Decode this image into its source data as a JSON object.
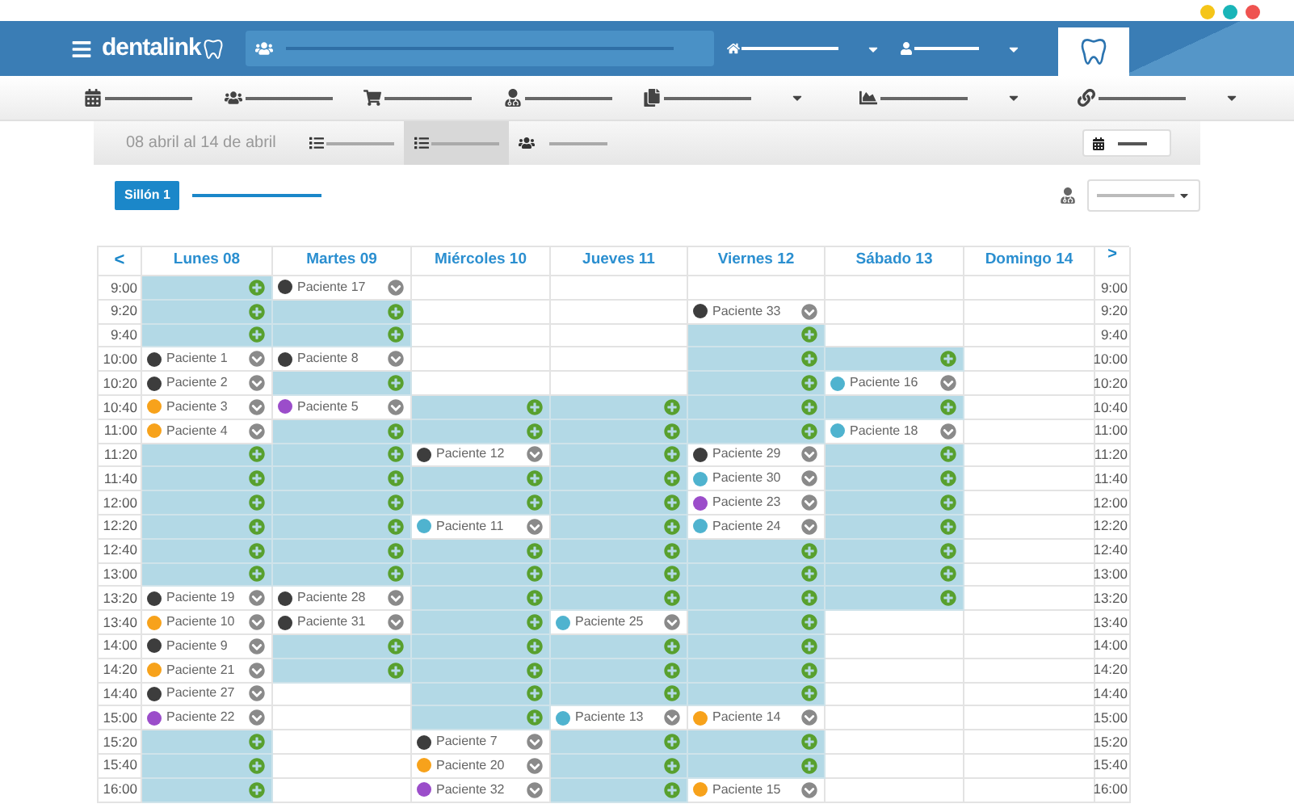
{
  "header": {
    "logo": "dentalink",
    "nav": [
      {
        "kind": "home",
        "dropdown": true
      },
      {
        "kind": "user",
        "dropdown": true
      }
    ]
  },
  "toolbar": [
    {
      "kind": "calendar",
      "dropdown": false
    },
    {
      "kind": "group",
      "dropdown": false
    },
    {
      "kind": "cart",
      "dropdown": false
    },
    {
      "kind": "doctor",
      "dropdown": false
    },
    {
      "kind": "files",
      "dropdown": true
    },
    {
      "kind": "chart",
      "dropdown": true
    },
    {
      "kind": "link",
      "dropdown": true
    }
  ],
  "subheader": {
    "date_range": "08 abril al 14 de abril",
    "view_tabs": [
      {
        "kind": "list",
        "selected": false
      },
      {
        "kind": "list",
        "selected": true
      },
      {
        "kind": "group",
        "selected": false
      }
    ]
  },
  "chair": {
    "label": "Sillón 1"
  },
  "calendar": {
    "prev": "<",
    "next": ">",
    "days": [
      "Lunes 08",
      "Martes 09",
      "Miércoles 10",
      "Jueves 11",
      "Viernes 12",
      "Sábado 13",
      "Domingo 14"
    ],
    "rows": [
      {
        "time": "9:00",
        "time_right": "9:00",
        "slots": [
          {
            "kind": "free"
          },
          {
            "kind": "appointment",
            "patient": "Paciente 17",
            "color": "#3d3d3d"
          },
          {
            "kind": "empty"
          },
          {
            "kind": "empty"
          },
          {
            "kind": "empty"
          },
          {
            "kind": "empty"
          },
          {
            "kind": "empty"
          }
        ]
      },
      {
        "time": "9:20",
        "time_right": "9:20",
        "slots": [
          {
            "kind": "free"
          },
          {
            "kind": "free"
          },
          {
            "kind": "empty"
          },
          {
            "kind": "empty"
          },
          {
            "kind": "appointment",
            "patient": "Paciente 33",
            "color": "#3d3d3d"
          },
          {
            "kind": "empty"
          },
          {
            "kind": "empty"
          }
        ]
      },
      {
        "time": "9:40",
        "time_right": "9:40",
        "slots": [
          {
            "kind": "free"
          },
          {
            "kind": "free"
          },
          {
            "kind": "empty"
          },
          {
            "kind": "empty"
          },
          {
            "kind": "free"
          },
          {
            "kind": "empty"
          },
          {
            "kind": "empty"
          }
        ]
      },
      {
        "time": "10:00",
        "time_right": "10:00",
        "slots": [
          {
            "kind": "appointment",
            "patient": "Paciente 1",
            "color": "#3d3d3d"
          },
          {
            "kind": "appointment",
            "patient": "Paciente 8",
            "color": "#3d3d3d"
          },
          {
            "kind": "empty"
          },
          {
            "kind": "empty"
          },
          {
            "kind": "free"
          },
          {
            "kind": "free"
          },
          {
            "kind": "empty"
          }
        ]
      },
      {
        "time": "10:20",
        "time_right": "10:20",
        "slots": [
          {
            "kind": "appointment",
            "patient": "Paciente 2",
            "color": "#3d3d3d"
          },
          {
            "kind": "free"
          },
          {
            "kind": "empty"
          },
          {
            "kind": "empty"
          },
          {
            "kind": "free"
          },
          {
            "kind": "appointment",
            "patient": "Paciente 16",
            "color": "#4fb3cf"
          },
          {
            "kind": "empty"
          }
        ]
      },
      {
        "time": "10:40",
        "time_right": "10:40",
        "slots": [
          {
            "kind": "appointment",
            "patient": "Paciente 3",
            "color": "#f7a21b"
          },
          {
            "kind": "appointment",
            "patient": "Paciente 5",
            "color": "#9b4dca"
          },
          {
            "kind": "free"
          },
          {
            "kind": "free"
          },
          {
            "kind": "free"
          },
          {
            "kind": "free"
          },
          {
            "kind": "empty"
          }
        ]
      },
      {
        "time": "11:00",
        "time_right": "11:00",
        "slots": [
          {
            "kind": "appointment",
            "patient": "Paciente 4",
            "color": "#f7a21b"
          },
          {
            "kind": "free"
          },
          {
            "kind": "free"
          },
          {
            "kind": "free"
          },
          {
            "kind": "free"
          },
          {
            "kind": "appointment",
            "patient": "Paciente 18",
            "color": "#4fb3cf"
          },
          {
            "kind": "empty"
          }
        ]
      },
      {
        "time": "11:20",
        "time_right": "11:20",
        "slots": [
          {
            "kind": "free"
          },
          {
            "kind": "free"
          },
          {
            "kind": "appointment",
            "patient": "Paciente 12",
            "color": "#3d3d3d"
          },
          {
            "kind": "free"
          },
          {
            "kind": "appointment",
            "patient": "Paciente 29",
            "color": "#3d3d3d"
          },
          {
            "kind": "free"
          },
          {
            "kind": "empty"
          }
        ]
      },
      {
        "time": "11:40",
        "time_right": "11:40",
        "slots": [
          {
            "kind": "free"
          },
          {
            "kind": "free"
          },
          {
            "kind": "free"
          },
          {
            "kind": "free"
          },
          {
            "kind": "appointment",
            "patient": "Paciente 30",
            "color": "#4fb3cf"
          },
          {
            "kind": "free"
          },
          {
            "kind": "empty"
          }
        ]
      },
      {
        "time": "12:00",
        "time_right": "12:00",
        "slots": [
          {
            "kind": "free"
          },
          {
            "kind": "free"
          },
          {
            "kind": "free"
          },
          {
            "kind": "free"
          },
          {
            "kind": "appointment",
            "patient": "Paciente 23",
            "color": "#9b4dca"
          },
          {
            "kind": "free"
          },
          {
            "kind": "empty"
          }
        ]
      },
      {
        "time": "12:20",
        "time_right": "12:20",
        "slots": [
          {
            "kind": "free"
          },
          {
            "kind": "free"
          },
          {
            "kind": "appointment",
            "patient": "Paciente 11",
            "color": "#4fb3cf"
          },
          {
            "kind": "free"
          },
          {
            "kind": "appointment",
            "patient": "Paciente 24",
            "color": "#4fb3cf"
          },
          {
            "kind": "free"
          },
          {
            "kind": "empty"
          }
        ]
      },
      {
        "time": "12:40",
        "time_right": "12:40",
        "slots": [
          {
            "kind": "free"
          },
          {
            "kind": "free"
          },
          {
            "kind": "free"
          },
          {
            "kind": "free"
          },
          {
            "kind": "free"
          },
          {
            "kind": "free"
          },
          {
            "kind": "empty"
          }
        ]
      },
      {
        "time": "13:00",
        "time_right": "13:00",
        "slots": [
          {
            "kind": "free"
          },
          {
            "kind": "free"
          },
          {
            "kind": "free"
          },
          {
            "kind": "free"
          },
          {
            "kind": "free"
          },
          {
            "kind": "free"
          },
          {
            "kind": "empty"
          }
        ]
      },
      {
        "time": "13:20",
        "time_right": "13:20",
        "slots": [
          {
            "kind": "appointment",
            "patient": "Paciente 19",
            "color": "#3d3d3d"
          },
          {
            "kind": "appointment",
            "patient": "Paciente 28",
            "color": "#3d3d3d"
          },
          {
            "kind": "free"
          },
          {
            "kind": "free"
          },
          {
            "kind": "free"
          },
          {
            "kind": "free"
          },
          {
            "kind": "empty"
          }
        ]
      },
      {
        "time": "13:40",
        "time_right": "13:40",
        "slots": [
          {
            "kind": "appointment",
            "patient": "Paciente 10",
            "color": "#f7a21b"
          },
          {
            "kind": "appointment",
            "patient": "Paciente 31",
            "color": "#3d3d3d"
          },
          {
            "kind": "free"
          },
          {
            "kind": "appointment",
            "patient": "Paciente 25",
            "color": "#4fb3cf"
          },
          {
            "kind": "free"
          },
          {
            "kind": "empty"
          },
          {
            "kind": "empty"
          }
        ]
      },
      {
        "time": "14:00",
        "time_right": "14:00",
        "slots": [
          {
            "kind": "appointment",
            "patient": "Paciente 9",
            "color": "#3d3d3d"
          },
          {
            "kind": "free"
          },
          {
            "kind": "free"
          },
          {
            "kind": "free"
          },
          {
            "kind": "free"
          },
          {
            "kind": "empty"
          },
          {
            "kind": "empty"
          }
        ]
      },
      {
        "time": "14:20",
        "time_right": "14:20",
        "slots": [
          {
            "kind": "appointment",
            "patient": "Paciente 21",
            "color": "#f7a21b"
          },
          {
            "kind": "free"
          },
          {
            "kind": "free"
          },
          {
            "kind": "free"
          },
          {
            "kind": "free"
          },
          {
            "kind": "empty"
          },
          {
            "kind": "empty"
          }
        ]
      },
      {
        "time": "14:40",
        "time_right": "14:40",
        "slots": [
          {
            "kind": "appointment",
            "patient": "Paciente 27",
            "color": "#3d3d3d"
          },
          {
            "kind": "empty"
          },
          {
            "kind": "free"
          },
          {
            "kind": "free"
          },
          {
            "kind": "free"
          },
          {
            "kind": "empty"
          },
          {
            "kind": "empty"
          }
        ]
      },
      {
        "time": "15:00",
        "time_right": "15:00",
        "slots": [
          {
            "kind": "appointment",
            "patient": "Paciente 22",
            "color": "#9b4dca"
          },
          {
            "kind": "empty"
          },
          {
            "kind": "free"
          },
          {
            "kind": "appointment",
            "patient": "Paciente 13",
            "color": "#4fb3cf"
          },
          {
            "kind": "appointment",
            "patient": "Paciente 14",
            "color": "#f7a21b"
          },
          {
            "kind": "empty"
          },
          {
            "kind": "empty"
          }
        ]
      },
      {
        "time": "15:20",
        "time_right": "15:20",
        "slots": [
          {
            "kind": "free"
          },
          {
            "kind": "empty"
          },
          {
            "kind": "appointment",
            "patient": "Paciente 7",
            "color": "#3d3d3d"
          },
          {
            "kind": "free"
          },
          {
            "kind": "free"
          },
          {
            "kind": "empty"
          },
          {
            "kind": "empty"
          }
        ]
      },
      {
        "time": "15:40",
        "time_right": "15:40",
        "slots": [
          {
            "kind": "free"
          },
          {
            "kind": "empty"
          },
          {
            "kind": "appointment",
            "patient": "Paciente 20",
            "color": "#f7a21b"
          },
          {
            "kind": "free"
          },
          {
            "kind": "free"
          },
          {
            "kind": "empty"
          },
          {
            "kind": "empty"
          }
        ]
      },
      {
        "time": "16:00",
        "time_right": "16:00",
        "slots": [
          {
            "kind": "free"
          },
          {
            "kind": "empty"
          },
          {
            "kind": "appointment",
            "patient": "Paciente 32",
            "color": "#9b4dca"
          },
          {
            "kind": "free"
          },
          {
            "kind": "appointment",
            "patient": "Paciente 15",
            "color": "#f7a21b"
          },
          {
            "kind": "empty"
          },
          {
            "kind": "empty"
          }
        ]
      }
    ]
  }
}
